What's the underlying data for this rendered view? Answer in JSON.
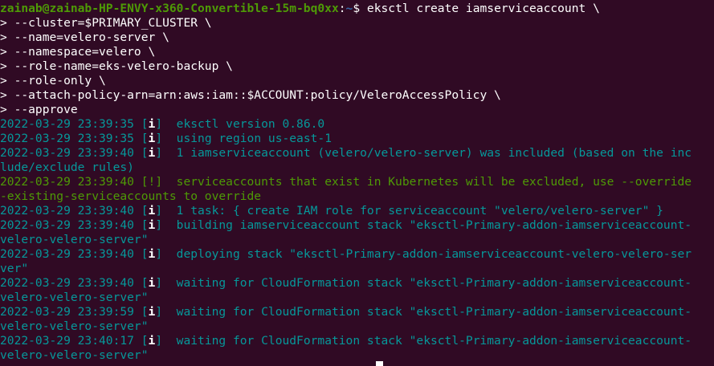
{
  "prompt": {
    "user_host": "zainab@zainab-HP-ENVY-x360-Convertible-15m-bq0xx",
    "colon": ":",
    "path": "~",
    "symbol": "$ ",
    "command": "eksctl create iamserviceaccount \\"
  },
  "continuations": [
    "> --cluster=$PRIMARY_CLUSTER \\",
    "> --name=velero-server \\",
    "> --namespace=velero \\",
    "> --role-name=eks-velero-backup \\",
    "> --role-only \\",
    "> --attach-policy-arn=arn:aws:iam::$ACCOUNT:policy/VeleroAccessPolicy \\",
    "> --approve"
  ],
  "log": [
    {
      "ts": "2022-03-29 23:39:35 [",
      "tag": "i",
      "close": "]",
      "msg": "  eksctl version 0.86.0"
    },
    {
      "ts": "2022-03-29 23:39:35 [",
      "tag": "i",
      "close": "]",
      "msg": "  using region us-east-1"
    },
    {
      "ts": "2022-03-29 23:39:40 [",
      "tag": "i",
      "close": "]",
      "msg": "  1 iamserviceaccount (velero/velero-server) was included (based on the inc"
    },
    {
      "wrap": "lude/exclude rules)"
    },
    {
      "ts": "2022-03-29 23:39:40 [",
      "tag": "!",
      "close": "]",
      "msg": "  serviceaccounts that exist in Kubernetes will be excluded, use --override",
      "warn": true
    },
    {
      "wrap": "-existing-serviceaccounts to override",
      "warn": true
    },
    {
      "ts": "2022-03-29 23:39:40 [",
      "tag": "i",
      "close": "]",
      "msg": "  1 task: { create IAM role for serviceaccount \"velero/velero-server\" }"
    },
    {
      "ts": "2022-03-29 23:39:40 [",
      "tag": "i",
      "close": "]",
      "msg": "  building iamserviceaccount stack \"eksctl-Primary-addon-iamserviceaccount-"
    },
    {
      "wrap": "velero-velero-server\""
    },
    {
      "ts": "2022-03-29 23:39:40 [",
      "tag": "i",
      "close": "]",
      "msg": "  deploying stack \"eksctl-Primary-addon-iamserviceaccount-velero-velero-ser"
    },
    {
      "wrap": "ver\""
    },
    {
      "ts": "2022-03-29 23:39:40 [",
      "tag": "i",
      "close": "]",
      "msg": "  waiting for CloudFormation stack \"eksctl-Primary-addon-iamserviceaccount-"
    },
    {
      "wrap": "velero-velero-server\""
    },
    {
      "ts": "2022-03-29 23:39:59 [",
      "tag": "i",
      "close": "]",
      "msg": "  waiting for CloudFormation stack \"eksctl-Primary-addon-iamserviceaccount-"
    },
    {
      "wrap": "velero-velero-server\""
    },
    {
      "ts": "2022-03-29 23:40:17 [",
      "tag": "i",
      "close": "]",
      "msg": "  waiting for CloudFormation stack \"eksctl-Primary-addon-iamserviceaccount-"
    },
    {
      "wrap": "velero-velero-server\""
    }
  ],
  "colors": {
    "background": "#300a24",
    "prompt_user": "#4e9a06",
    "prompt_path": "#3465a4",
    "log_info": "#06989a",
    "log_warn": "#4e9a06"
  }
}
